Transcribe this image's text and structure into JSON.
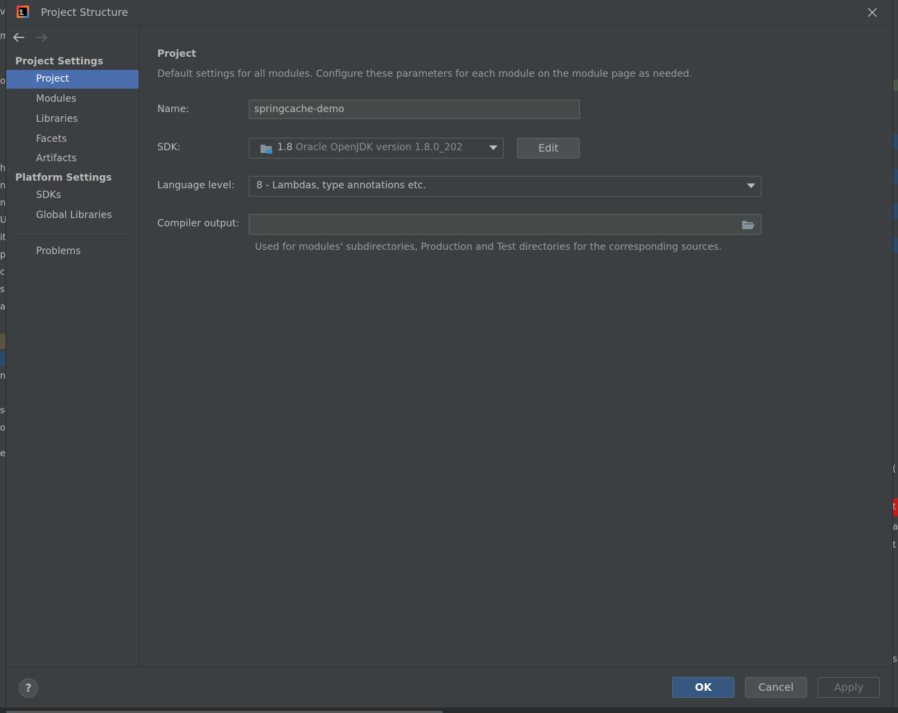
{
  "window": {
    "title": "Project Structure"
  },
  "background_left_fragments": [
    "vi",
    "m",
    "o",
    "h",
    "nf",
    "nt",
    "U",
    "it",
    "p",
    "cl",
    "s",
    "at",
    "n",
    "sc",
    "o.",
    "e"
  ],
  "background_right_fragments": [
    "(",
    "t",
    "a",
    "t",
    "s"
  ],
  "sidebar": {
    "project_settings_header": "Project Settings",
    "project_items": [
      {
        "label": "Project",
        "selected": true
      },
      {
        "label": "Modules",
        "selected": false
      },
      {
        "label": "Libraries",
        "selected": false
      },
      {
        "label": "Facets",
        "selected": false
      },
      {
        "label": "Artifacts",
        "selected": false
      }
    ],
    "platform_settings_header": "Platform Settings",
    "platform_items": [
      {
        "label": "SDKs"
      },
      {
        "label": "Global Libraries"
      }
    ],
    "problems_label": "Problems"
  },
  "main": {
    "heading": "Project",
    "description": "Default settings for all modules. Configure these parameters for each module on the module page as needed.",
    "name_label": "Name:",
    "name_value": "springcache-demo",
    "sdk_label": "SDK:",
    "sdk_version": "1.8",
    "sdk_name": "Oracle OpenJDK version 1.8.0_202",
    "edit_button": "Edit",
    "language_level_label": "Language level:",
    "language_level_value": "8 - Lambdas, type annotations etc.",
    "compiler_output_label": "Compiler output:",
    "compiler_output_value": "",
    "compiler_output_hint": "Used for modules' subdirectories, Production and Test directories for the corresponding sources."
  },
  "footer": {
    "help_label": "?",
    "ok_label": "OK",
    "cancel_label": "Cancel",
    "apply_label": "Apply"
  },
  "colors": {
    "accent": "#4b6eaf",
    "ok_button": "#365880",
    "background": "#3c3f41"
  },
  "icons": [
    "app-logo-icon",
    "close-icon",
    "back-arrow-icon",
    "forward-arrow-icon",
    "folder-icon",
    "chevron-down-icon",
    "browse-folder-icon",
    "help-icon"
  ]
}
